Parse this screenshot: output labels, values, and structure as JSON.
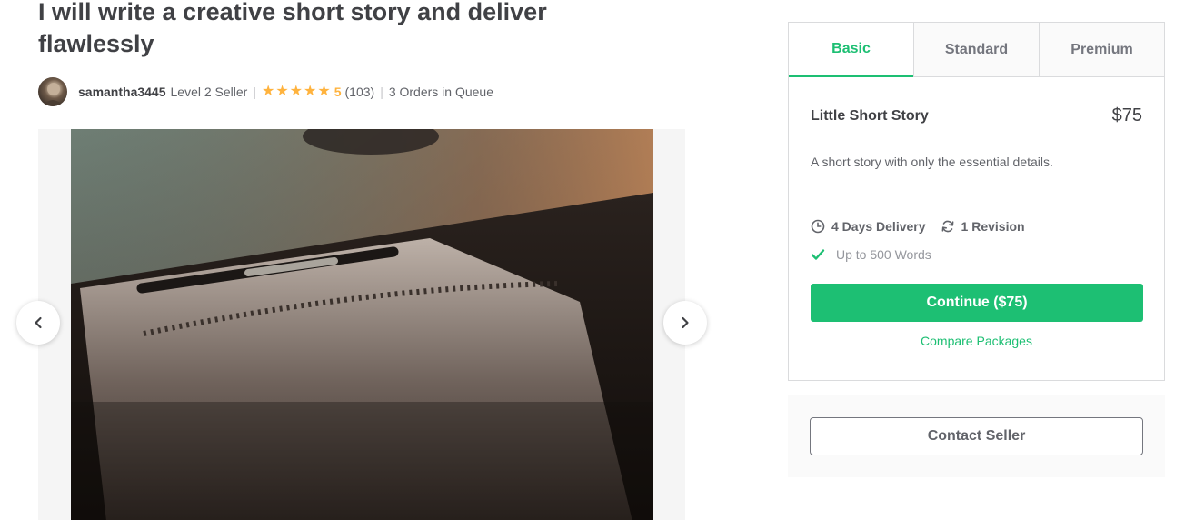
{
  "gig": {
    "title": "I will write a creative short story and deliver flawlessly"
  },
  "seller": {
    "username": "samantha3445",
    "level": "Level 2 Seller",
    "rating": "5",
    "rating_count": "(103)",
    "stars": 5,
    "orders_in_queue": "3 Orders in Queue",
    "star_color": "#ffb33e"
  },
  "gallery": {
    "prev_icon": "chevron-left-icon",
    "next_icon": "chevron-right-icon"
  },
  "packages": {
    "tabs": [
      {
        "label": "Basic",
        "active": true
      },
      {
        "label": "Standard",
        "active": false
      },
      {
        "label": "Premium",
        "active": false
      }
    ],
    "selected": {
      "name": "Little Short Story",
      "price": "$75",
      "description": "A short story with only the essential details.",
      "delivery": "4 Days Delivery",
      "revisions": "1 Revision",
      "features": [
        "Up to 500 Words"
      ]
    },
    "continue_label": "Continue ($75)",
    "compare_label": "Compare Packages"
  },
  "contact": {
    "label": "Contact Seller"
  },
  "colors": {
    "accent": "#1dbf73",
    "text": "#404145",
    "muted": "#62646a"
  }
}
